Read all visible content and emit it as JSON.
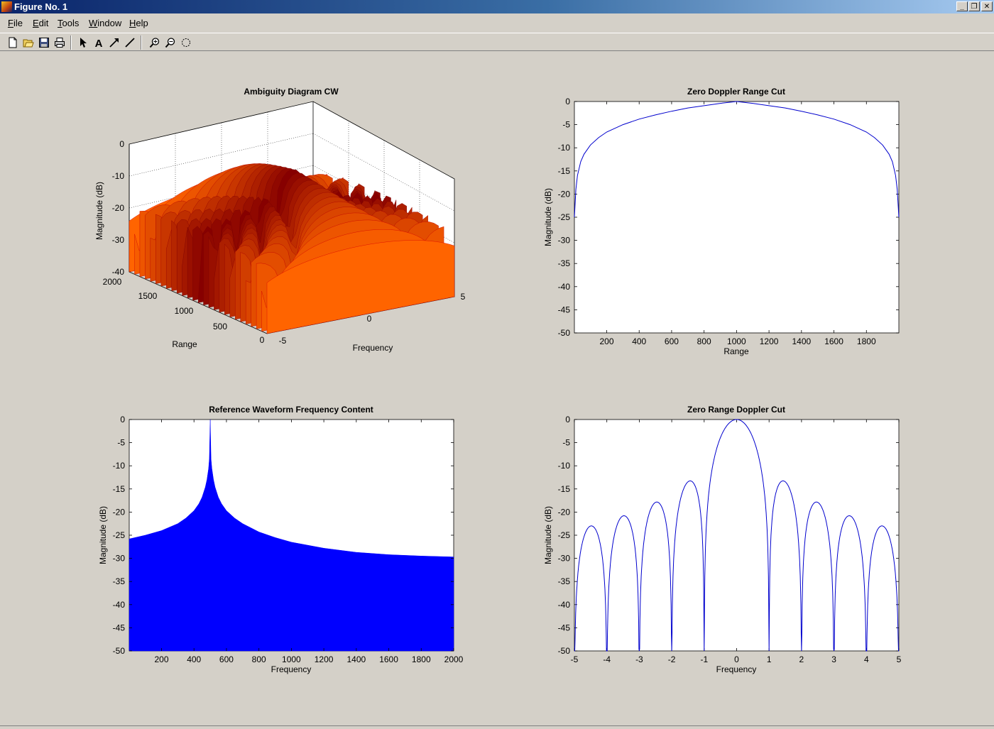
{
  "window": {
    "title": "Figure No. 1",
    "controls": {
      "minimize": "_",
      "restore": "❐",
      "close": "✕"
    }
  },
  "menu": {
    "items": [
      "File",
      "Edit",
      "Tools",
      "Window",
      "Help"
    ]
  },
  "toolbar": {
    "tools": [
      "new-file-icon",
      "open-folder-icon",
      "save-icon",
      "print-icon",
      "select-arrow-icon",
      "text-icon",
      "arrow-icon",
      "line-icon",
      "zoom-in-icon",
      "zoom-out-icon",
      "rotate-icon"
    ]
  },
  "colors": {
    "background": "#d4d0c8",
    "axes_bg": "#ffffff",
    "line": "#0000cd",
    "fill": "#0000ff",
    "surface_dark": "#8b0000",
    "surface_bright": "#ff3000"
  },
  "chart_data": [
    {
      "id": "ambiguity",
      "type": "surface",
      "title": "Ambiguity Diagram CW",
      "xlabel": "Range",
      "ylabel": "Frequency",
      "zlabel": "Magnitude (dB)",
      "x_ticks": [
        "0",
        "500",
        "1000",
        "1500",
        "2000"
      ],
      "y_ticks": [
        "-5",
        "0",
        "5"
      ],
      "z_ticks": [
        "0",
        "-10",
        "-20",
        "-30",
        "-40"
      ],
      "xlim": [
        0,
        2000
      ],
      "ylim": [
        -5,
        5
      ],
      "zlim": [
        -40,
        0
      ],
      "grid": true
    },
    {
      "id": "zero-doppler",
      "type": "line",
      "title": "Zero Doppler Range Cut",
      "xlabel": "Range",
      "ylabel": "Magnitude (dB)",
      "xlim": [
        1,
        2000
      ],
      "ylim": [
        -50,
        0
      ],
      "x_ticks": [
        200,
        400,
        600,
        800,
        1000,
        1200,
        1400,
        1600,
        1800
      ],
      "y_ticks": [
        0,
        -5,
        -10,
        -15,
        -20,
        -25,
        -30,
        -35,
        -40,
        -45,
        -50
      ],
      "x": [
        1,
        10,
        20,
        40,
        60,
        100,
        150,
        200,
        300,
        400,
        500,
        600,
        700,
        800,
        900,
        1000,
        1100,
        1200,
        1300,
        1400,
        1500,
        1600,
        1700,
        1800,
        1850,
        1900,
        1940,
        1960,
        1980,
        1990,
        2000
      ],
      "y": [
        -25,
        -19,
        -16,
        -13,
        -11.4,
        -9.4,
        -7.8,
        -6.6,
        -5,
        -3.8,
        -2.9,
        -2.1,
        -1.4,
        -0.9,
        -0.4,
        0,
        -0.4,
        -0.9,
        -1.4,
        -2.1,
        -2.9,
        -3.8,
        -5,
        -6.6,
        -7.8,
        -9.4,
        -11.4,
        -13,
        -16,
        -19,
        -25
      ]
    },
    {
      "id": "reference-freq",
      "type": "area",
      "title": "Reference Waveform Frequency Content",
      "xlabel": "Frequency",
      "ylabel": "Magnitude (dB)",
      "xlim": [
        1,
        2000
      ],
      "ylim": [
        -50,
        0
      ],
      "x_ticks": [
        200,
        400,
        600,
        800,
        1000,
        1200,
        1400,
        1600,
        1800,
        2000
      ],
      "y_ticks": [
        0,
        -5,
        -10,
        -15,
        -20,
        -25,
        -30,
        -35,
        -40,
        -45,
        -50
      ],
      "x": [
        1,
        100,
        200,
        300,
        350,
        400,
        430,
        450,
        470,
        480,
        490,
        495,
        500,
        505,
        510,
        520,
        530,
        550,
        570,
        600,
        650,
        700,
        800,
        900,
        1000,
        1200,
        1400,
        1600,
        1800,
        2000
      ],
      "y": [
        -25.8,
        -25,
        -24,
        -22.5,
        -21.3,
        -19.7,
        -18.2,
        -16.8,
        -14.6,
        -13,
        -10.6,
        -8.5,
        0,
        -8.5,
        -10.6,
        -13,
        -14.6,
        -16.8,
        -18.2,
        -19.7,
        -21.3,
        -22.5,
        -24.3,
        -25.5,
        -26.5,
        -27.8,
        -28.7,
        -29.2,
        -29.5,
        -29.7
      ]
    },
    {
      "id": "zero-range",
      "type": "line",
      "title": "Zero Range Doppler Cut",
      "xlabel": "Frequency",
      "ylabel": "Magnitude (dB)",
      "xlim": [
        -5,
        5
      ],
      "ylim": [
        -50,
        0
      ],
      "x_ticks": [
        -5,
        -4,
        -3,
        -2,
        -1,
        0,
        1,
        2,
        3,
        4,
        5
      ],
      "y_ticks": [
        0,
        -5,
        -10,
        -15,
        -20,
        -25,
        -30,
        -35,
        -40,
        -45,
        -50
      ],
      "function": "20*log10(|sinc(x)|)",
      "nulls": [
        -4,
        -3,
        -2,
        -1,
        1,
        2,
        3,
        4
      ]
    }
  ]
}
